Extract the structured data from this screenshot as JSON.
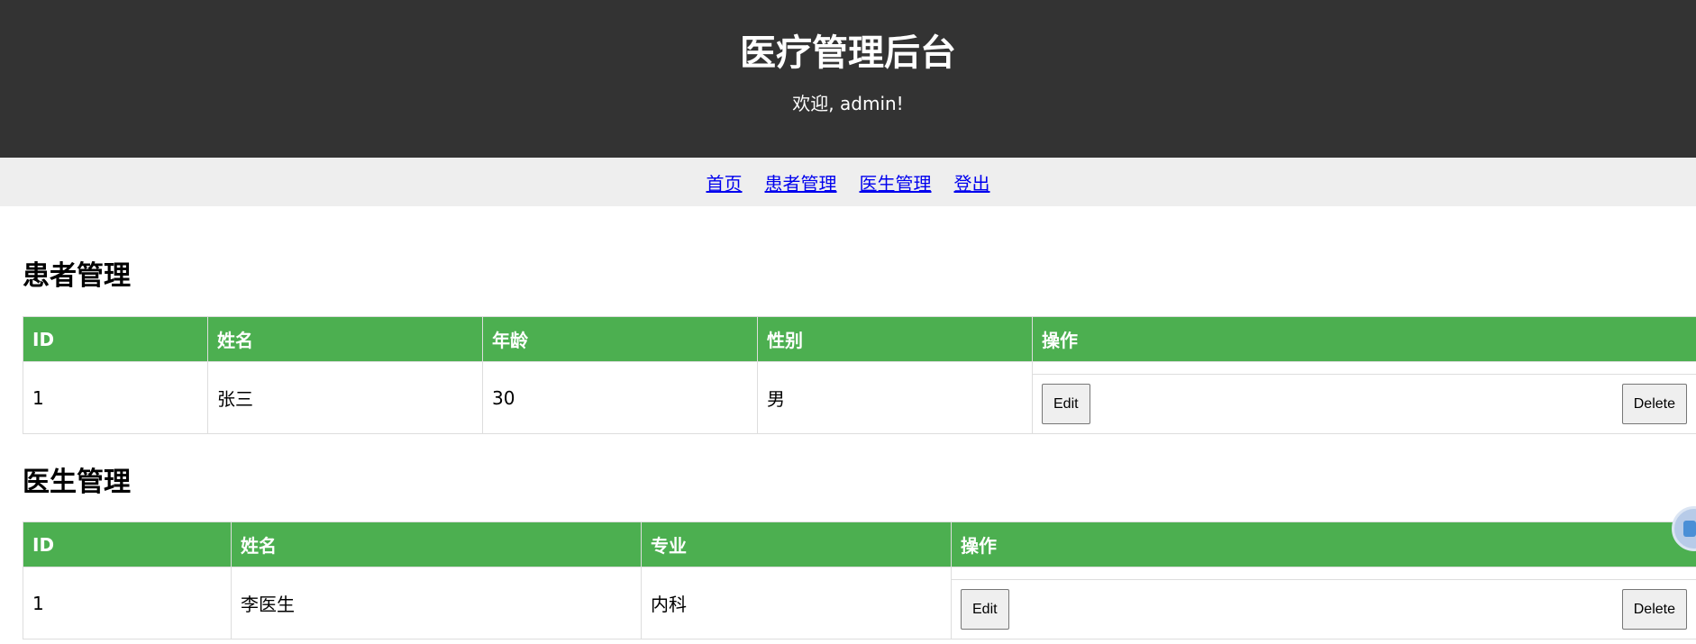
{
  "header": {
    "title": "医疗管理后台",
    "welcome": "欢迎, admin!"
  },
  "nav": {
    "items": [
      "首页",
      "患者管理",
      "医生管理",
      "登出"
    ]
  },
  "patients": {
    "title": "患者管理",
    "columns": [
      "ID",
      "姓名",
      "年龄",
      "性别",
      "操作"
    ],
    "rows": [
      {
        "id": "1",
        "name": "张三",
        "age": "30",
        "gender": "男"
      }
    ],
    "edit_label": "Edit",
    "delete_label": "Delete"
  },
  "doctors": {
    "title": "医生管理",
    "columns": [
      "ID",
      "姓名",
      "专业",
      "操作"
    ],
    "rows": [
      {
        "id": "1",
        "name": "李医生",
        "specialty": "内科"
      }
    ],
    "edit_label": "Edit",
    "delete_label": "Delete"
  },
  "floating_widget": {
    "icon": "assistant-icon",
    "color": "#4a8fd6"
  }
}
